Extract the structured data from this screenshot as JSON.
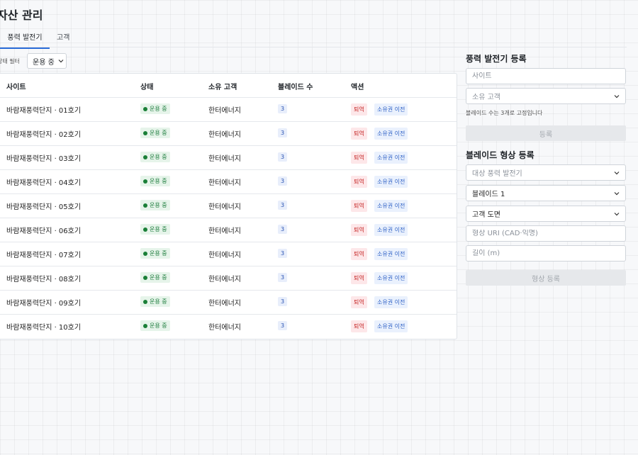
{
  "page": {
    "title": "자산 관리"
  },
  "tabs": [
    {
      "label": "풍력 발전기",
      "active": true
    },
    {
      "label": "고객",
      "active": false
    }
  ],
  "filter": {
    "label": "상태 필터",
    "value": "운용 중"
  },
  "table": {
    "headers": {
      "site": "사이트",
      "status": "상태",
      "owner": "소유 고객",
      "blades": "블레이드 수",
      "actions": "액션"
    },
    "rows": [
      {
        "site": "바람재풍력단지 · 01호기",
        "status": "운용 중",
        "owner": "한터에너지",
        "blades": "3",
        "retire": "퇴역",
        "transfer": "소유권 이전"
      },
      {
        "site": "바람재풍력단지 · 02호기",
        "status": "운용 중",
        "owner": "한터에너지",
        "blades": "3",
        "retire": "퇴역",
        "transfer": "소유권 이전"
      },
      {
        "site": "바람재풍력단지 · 03호기",
        "status": "운용 중",
        "owner": "한터에너지",
        "blades": "3",
        "retire": "퇴역",
        "transfer": "소유권 이전"
      },
      {
        "site": "바람재풍력단지 · 04호기",
        "status": "운용 중",
        "owner": "한터에너지",
        "blades": "3",
        "retire": "퇴역",
        "transfer": "소유권 이전"
      },
      {
        "site": "바람재풍력단지 · 05호기",
        "status": "운용 중",
        "owner": "한터에너지",
        "blades": "3",
        "retire": "퇴역",
        "transfer": "소유권 이전"
      },
      {
        "site": "바람재풍력단지 · 06호기",
        "status": "운용 중",
        "owner": "한터에너지",
        "blades": "3",
        "retire": "퇴역",
        "transfer": "소유권 이전"
      },
      {
        "site": "바람재풍력단지 · 07호기",
        "status": "운용 중",
        "owner": "한터에너지",
        "blades": "3",
        "retire": "퇴역",
        "transfer": "소유권 이전"
      },
      {
        "site": "바람재풍력단지 · 08호기",
        "status": "운용 중",
        "owner": "한터에너지",
        "blades": "3",
        "retire": "퇴역",
        "transfer": "소유권 이전"
      },
      {
        "site": "바람재풍력단지 · 09호기",
        "status": "운용 중",
        "owner": "한터에너지",
        "blades": "3",
        "retire": "퇴역",
        "transfer": "소유권 이전"
      },
      {
        "site": "바람재풍력단지 · 10호기",
        "status": "운용 중",
        "owner": "한터에너지",
        "blades": "3",
        "retire": "퇴역",
        "transfer": "소유권 이전"
      }
    ]
  },
  "turbine_form": {
    "title": "풍력 발전기 등록",
    "site_placeholder": "사이트",
    "owner_placeholder": "소유 고객",
    "hint": "블레이드 수는 3개로 고정입니다",
    "submit_label": "등록"
  },
  "blade_form": {
    "title": "블레이드 형상 등록",
    "target_placeholder": "대상 풍력 발전기",
    "blade_value": "블레이드 1",
    "source_value": "고객 도면",
    "uri_placeholder": "형상 URI (CAD·익명)",
    "length_placeholder": "길이 (m)",
    "submit_label": "형상 등록"
  },
  "colors": {
    "accent": "#2b6cd8",
    "status_green": "#1a7f37",
    "retire_red": "#c62828",
    "transfer_blue": "#2c5fc5"
  }
}
